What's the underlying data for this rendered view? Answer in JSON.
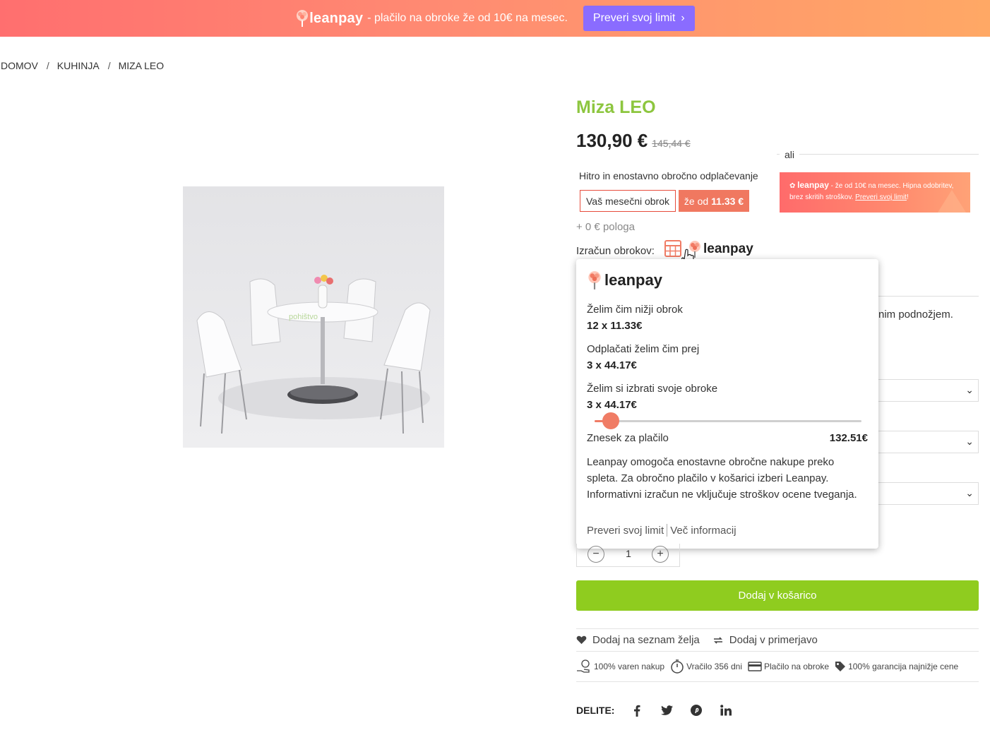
{
  "promo": {
    "brand": "leanpay",
    "text": "- plačilo na obroke že od 10€ na mesec.",
    "button_label": "Preveri svoj limit",
    "button_chevron": "›"
  },
  "breadcrumb": {
    "items": [
      "DOMOV",
      "KUHINJA",
      "MIZA LEO"
    ],
    "separator": "/"
  },
  "product": {
    "title": "Miza LEO",
    "price": "130,90 €",
    "old_price": "145,44 €",
    "image_watermark": "pohištvo"
  },
  "installment": {
    "ali": "ali",
    "hitro_text": "Hitro in enostavno obročno odplačevanje",
    "mesecni_label": "Vaš mesečni obrok",
    "zeod_prefix": "že od",
    "zeod_value": "11.33 €",
    "pologa": "+ 0 € pologa",
    "izracun_label": "Izračun obrokov:",
    "brand": "leanpay"
  },
  "side_banner": {
    "brand": "leanpay",
    "text1": "- že od 10€ na mesec. Hipna odobritev,",
    "text2": "brez skritih stroškov.",
    "link": "Preveri svoj limit",
    "end": "!"
  },
  "behind": {
    "desc_fragment": "nim podnožjem."
  },
  "popup": {
    "brand": "leanpay",
    "options": [
      {
        "label": "Želim čim nižji obrok",
        "value": "12 x 11.33€"
      },
      {
        "label": "Odplačati želim čim prej",
        "value": "3 x 44.17€"
      },
      {
        "label": "Želim si izbrati svoje obroke",
        "value": "3 x 44.17€"
      }
    ],
    "slider_level": 0.06,
    "znesek_label": "Znesek za plačilo",
    "znesek_value": "132.51€",
    "description": "Leanpay omogoča enostavne obročne nakupe preko spleta. Za obročno plačilo v košarici izberi Leanpay. Informativni izračun ne vključuje stroškov ocene tveganja.",
    "link_limit": "Preveri svoj limit",
    "link_info": "Več informacij"
  },
  "quantity": {
    "minus": "−",
    "value": "1",
    "plus": "+"
  },
  "cart": {
    "add_label": "Dodaj v košarico"
  },
  "actions": {
    "wishlist": "Dodaj na seznam želja",
    "compare": "Dodaj v primerjavo"
  },
  "features": [
    "100% varen nakup",
    "Vračilo 356 dni",
    "Plačilo na obroke",
    "100% garancija najnižje cene"
  ],
  "share": {
    "label": "DELITE:",
    "icons": [
      "facebook-icon",
      "twitter-icon",
      "pinterest-icon",
      "linkedin-icon"
    ]
  },
  "colors": {
    "accent_green": "#8dc63f",
    "cart_green": "#8fcc1f",
    "leanpay_coral": "#f07c65",
    "promo_purple": "#8a6cff"
  }
}
